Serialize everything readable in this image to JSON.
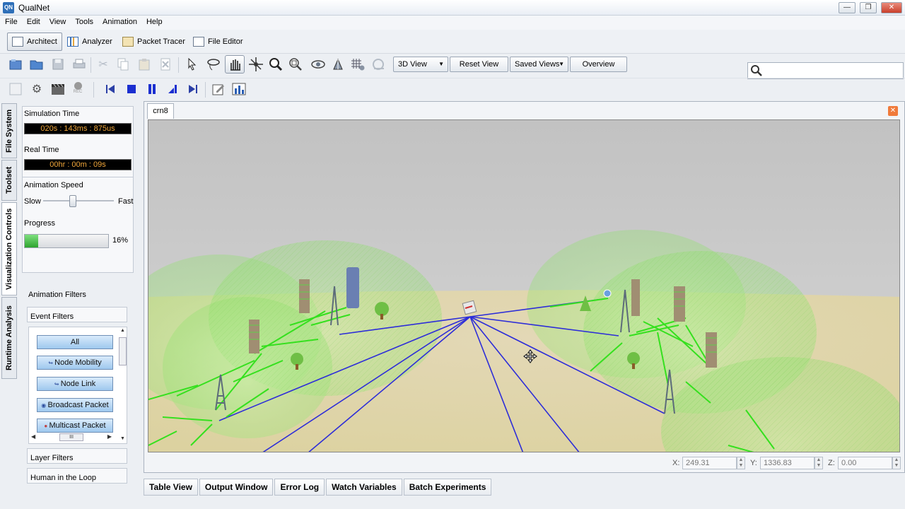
{
  "window": {
    "app_icon_text": "QN",
    "title": "QualNet",
    "min_glyph": "—",
    "max_glyph": "❐",
    "close_glyph": "✕"
  },
  "menu": [
    "File",
    "Edit",
    "View",
    "Tools",
    "Animation",
    "Help"
  ],
  "modes": [
    "Architect",
    "Analyzer",
    "Packet Tracer",
    "File Editor"
  ],
  "search": {
    "placeholder": ""
  },
  "toolbar": {
    "view_select": "3D View",
    "reset_view": "Reset View",
    "saved_views": "Saved Views",
    "overview": "Overview",
    "rec_label": "REC"
  },
  "side_tabs": [
    "File System",
    "Toolset",
    "Visualization Controls",
    "Runtime Analysis"
  ],
  "visualization": {
    "simulation_time_label": "Simulation Time",
    "simulation_time": "020s : 143ms : 875us",
    "real_time_label": "Real Time",
    "real_time": "00hr : 00m : 09s",
    "animation_speed_label": "Animation Speed",
    "slow_label": "Slow",
    "fast_label": "Fast",
    "animation_speed_level": 0.42,
    "progress_label": "Progress",
    "progress_value": 16,
    "progress_text": "16%"
  },
  "filters": {
    "animation_filters_label": "Animation Filters",
    "event_filters_label": "Event Filters",
    "buttons": [
      "All",
      "Node Mobility",
      "Node Link",
      "Broadcast Packet",
      "Multicast Packet"
    ],
    "scroll_grip": "III",
    "layer_filters_label": "Layer Filters",
    "human_in_loop_label": "Human in the Loop"
  },
  "canvas": {
    "tab_label": "crn8"
  },
  "coords": {
    "x_label": "X:",
    "x_value": "249.31",
    "y_label": "Y:",
    "y_value": "1336.83",
    "z_label": "Z:",
    "z_value": "0.00"
  },
  "bottom_tabs": [
    "Table View",
    "Output Window",
    "Error Log",
    "Watch Variables",
    "Batch Experiments"
  ],
  "colors": {
    "accent_blue": "#2d2dd8",
    "signal_green": "#35e01e",
    "lcd_text": "#f0a63a",
    "progress_green": "#3dbb3d"
  }
}
